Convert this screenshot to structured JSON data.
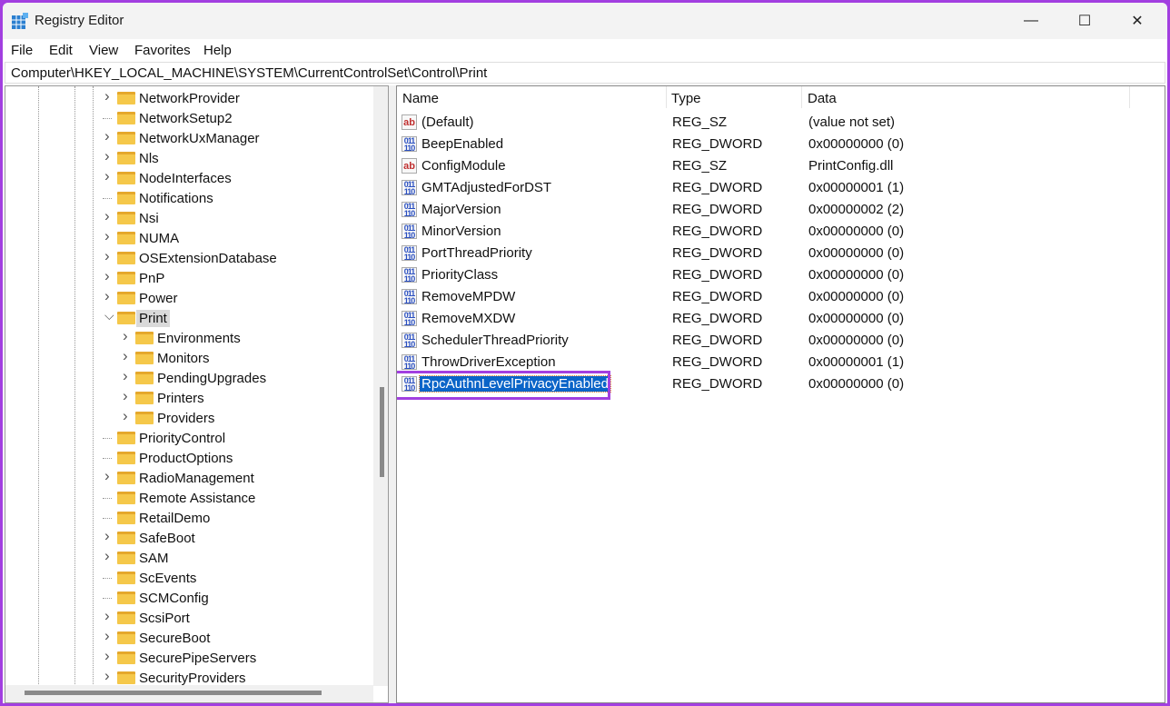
{
  "window": {
    "title": "Registry Editor",
    "minimize": "—",
    "maximize": "☐",
    "close": "✕"
  },
  "menu": [
    "File",
    "Edit",
    "View",
    "Favorites",
    "Help"
  ],
  "address": "Computer\\HKEY_LOCAL_MACHINE\\SYSTEM\\CurrentControlSet\\Control\\Print",
  "tree": [
    {
      "label": "NetworkProvider",
      "level": 0,
      "expand": "collapsed"
    },
    {
      "label": "NetworkSetup2",
      "level": 0,
      "expand": "none"
    },
    {
      "label": "NetworkUxManager",
      "level": 0,
      "expand": "collapsed"
    },
    {
      "label": "Nls",
      "level": 0,
      "expand": "collapsed"
    },
    {
      "label": "NodeInterfaces",
      "level": 0,
      "expand": "collapsed"
    },
    {
      "label": "Notifications",
      "level": 0,
      "expand": "none"
    },
    {
      "label": "Nsi",
      "level": 0,
      "expand": "collapsed"
    },
    {
      "label": "NUMA",
      "level": 0,
      "expand": "collapsed"
    },
    {
      "label": "OSExtensionDatabase",
      "level": 0,
      "expand": "collapsed"
    },
    {
      "label": "PnP",
      "level": 0,
      "expand": "collapsed"
    },
    {
      "label": "Power",
      "level": 0,
      "expand": "collapsed"
    },
    {
      "label": "Print",
      "level": 0,
      "expand": "expanded",
      "selected": true
    },
    {
      "label": "Environments",
      "level": 1,
      "expand": "collapsed"
    },
    {
      "label": "Monitors",
      "level": 1,
      "expand": "collapsed"
    },
    {
      "label": "PendingUpgrades",
      "level": 1,
      "expand": "collapsed"
    },
    {
      "label": "Printers",
      "level": 1,
      "expand": "collapsed"
    },
    {
      "label": "Providers",
      "level": 1,
      "expand": "collapsed"
    },
    {
      "label": "PriorityControl",
      "level": 0,
      "expand": "none"
    },
    {
      "label": "ProductOptions",
      "level": 0,
      "expand": "none"
    },
    {
      "label": "RadioManagement",
      "level": 0,
      "expand": "collapsed"
    },
    {
      "label": "Remote Assistance",
      "level": 0,
      "expand": "none"
    },
    {
      "label": "RetailDemo",
      "level": 0,
      "expand": "none"
    },
    {
      "label": "SafeBoot",
      "level": 0,
      "expand": "collapsed"
    },
    {
      "label": "SAM",
      "level": 0,
      "expand": "collapsed"
    },
    {
      "label": "ScEvents",
      "level": 0,
      "expand": "none"
    },
    {
      "label": "SCMConfig",
      "level": 0,
      "expand": "none"
    },
    {
      "label": "ScsiPort",
      "level": 0,
      "expand": "collapsed"
    },
    {
      "label": "SecureBoot",
      "level": 0,
      "expand": "collapsed"
    },
    {
      "label": "SecurePipeServers",
      "level": 0,
      "expand": "collapsed"
    },
    {
      "label": "SecurityProviders",
      "level": 0,
      "expand": "collapsed"
    }
  ],
  "columns": {
    "name": "Name",
    "type": "Type",
    "data": "Data"
  },
  "values": [
    {
      "name": "(Default)",
      "type": "REG_SZ",
      "data": "(value not set)",
      "icon": "string"
    },
    {
      "name": "BeepEnabled",
      "type": "REG_DWORD",
      "data": "0x00000000 (0)",
      "icon": "binary"
    },
    {
      "name": "ConfigModule",
      "type": "REG_SZ",
      "data": "PrintConfig.dll",
      "icon": "string"
    },
    {
      "name": "GMTAdjustedForDST",
      "type": "REG_DWORD",
      "data": "0x00000001 (1)",
      "icon": "binary"
    },
    {
      "name": "MajorVersion",
      "type": "REG_DWORD",
      "data": "0x00000002 (2)",
      "icon": "binary"
    },
    {
      "name": "MinorVersion",
      "type": "REG_DWORD",
      "data": "0x00000000 (0)",
      "icon": "binary"
    },
    {
      "name": "PortThreadPriority",
      "type": "REG_DWORD",
      "data": "0x00000000 (0)",
      "icon": "binary"
    },
    {
      "name": "PriorityClass",
      "type": "REG_DWORD",
      "data": "0x00000000 (0)",
      "icon": "binary"
    },
    {
      "name": "RemoveMPDW",
      "type": "REG_DWORD",
      "data": "0x00000000 (0)",
      "icon": "binary"
    },
    {
      "name": "RemoveMXDW",
      "type": "REG_DWORD",
      "data": "0x00000000 (0)",
      "icon": "binary"
    },
    {
      "name": "SchedulerThreadPriority",
      "type": "REG_DWORD",
      "data": "0x00000000 (0)",
      "icon": "binary"
    },
    {
      "name": "ThrowDriverException",
      "type": "REG_DWORD",
      "data": "0x00000001 (1)",
      "icon": "binary"
    },
    {
      "name": "RpcAuthnLevelPrivacyEnabled",
      "type": "REG_DWORD",
      "data": "0x00000000 (0)",
      "icon": "binary",
      "selected": true
    }
  ],
  "colors": {
    "highlight_border": "#a23fe0",
    "selection": "#0a64c8"
  }
}
